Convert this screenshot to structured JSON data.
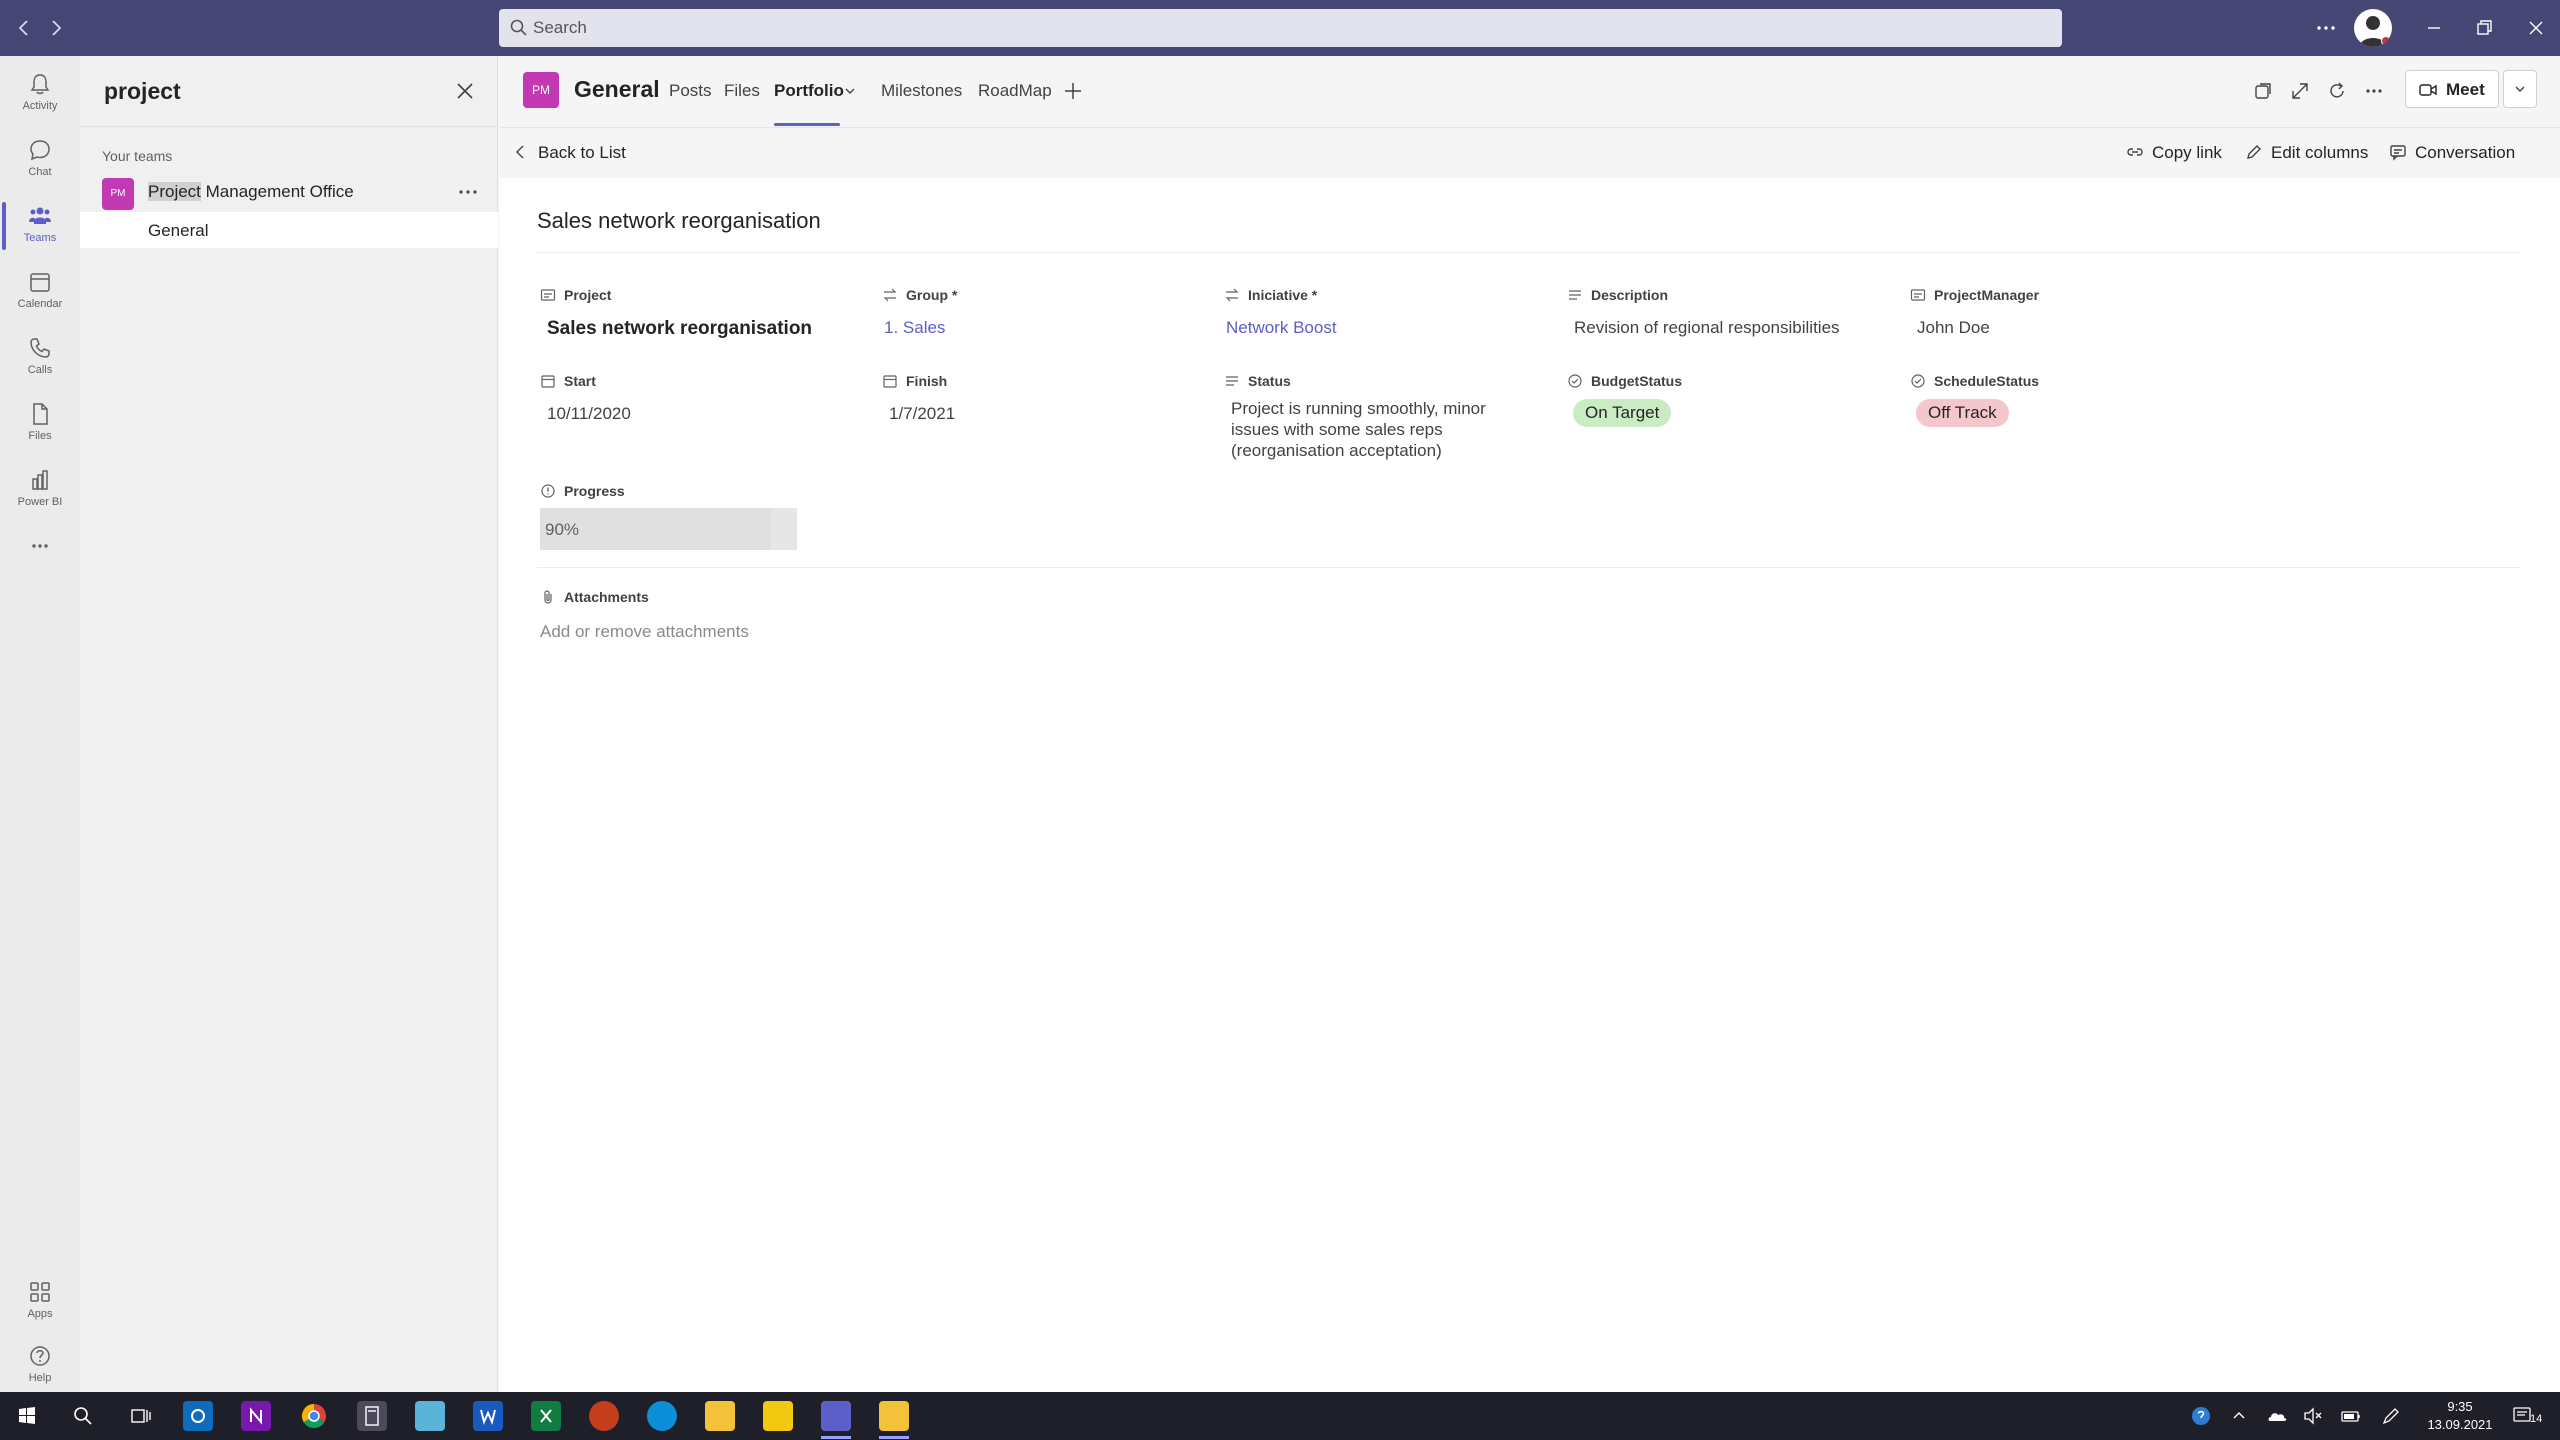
{
  "app": {
    "search_placeholder": "Search"
  },
  "rail": [
    {
      "label": "Activity",
      "icon": "bell-icon"
    },
    {
      "label": "Chat",
      "icon": "chat-icon"
    },
    {
      "label": "Teams",
      "icon": "teams-icon"
    },
    {
      "label": "Calendar",
      "icon": "calendar-icon"
    },
    {
      "label": "Calls",
      "icon": "phone-icon"
    },
    {
      "label": "Files",
      "icon": "file-icon"
    },
    {
      "label": "Power BI",
      "icon": "powerbi-icon"
    },
    {
      "label": "Apps",
      "icon": "apps-icon"
    },
    {
      "label": "Help",
      "icon": "help-icon"
    }
  ],
  "left_panel": {
    "title": "project",
    "section_label": "Your teams",
    "team": {
      "badge": "PM",
      "name_highlight": "Project",
      "name_rest": " Management Office"
    },
    "channel": "General"
  },
  "header": {
    "badge": "PM",
    "channel_title": "General",
    "tabs": [
      "Posts",
      "Files",
      "Portfolio",
      "Milestones",
      "RoadMap"
    ],
    "active_tab": "Portfolio",
    "meet_label": "Meet"
  },
  "command_bar": {
    "back": "Back to List",
    "copy_link": "Copy link",
    "edit_columns": "Edit columns",
    "conversation": "Conversation"
  },
  "item": {
    "title": "Sales network reorganisation",
    "fields": {
      "project": {
        "label": "Project",
        "value": "Sales network reorganisation"
      },
      "group": {
        "label": "Group *",
        "value": "1. Sales"
      },
      "iniciative": {
        "label": "Iniciative *",
        "value": "Network Boost"
      },
      "description": {
        "label": "Description",
        "value": "Revision of regional responsibilities"
      },
      "project_manager": {
        "label": "ProjectManager",
        "value": "John Doe"
      },
      "start": {
        "label": "Start",
        "value": "10/11/2020"
      },
      "finish": {
        "label": "Finish",
        "value": "1/7/2021"
      },
      "status": {
        "label": "Status",
        "value": "Project is running smoothly, minor issues with some sales reps (reorganisation acceptation)"
      },
      "budget_status": {
        "label": "BudgetStatus",
        "value": "On Target",
        "color": "#c9ecc3"
      },
      "schedule_status": {
        "label": "ScheduleStatus",
        "value": "Off Track",
        "color": "#f4c7cd"
      },
      "progress": {
        "label": "Progress",
        "value": "90%",
        "fraction": 0.9
      }
    },
    "attachments": {
      "label": "Attachments",
      "hint": "Add or remove attachments"
    }
  },
  "taskbar": {
    "time": "9:35",
    "date": "13.09.2021",
    "notifications": "14"
  },
  "colors": {
    "titlebar": "#464775",
    "accent": "#5b5fc7",
    "team_badge": "#c239b3"
  }
}
